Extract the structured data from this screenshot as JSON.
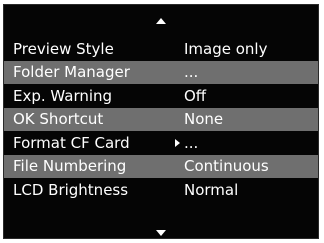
{
  "menu": {
    "items": [
      {
        "label": "Preview Style",
        "value": "Image only",
        "shaded": false,
        "pointer": false
      },
      {
        "label": "Folder Manager",
        "value": "...",
        "shaded": true,
        "pointer": false
      },
      {
        "label": "Exp. Warning",
        "value": "Off",
        "shaded": false,
        "pointer": false
      },
      {
        "label": "OK Shortcut",
        "value": "None",
        "shaded": true,
        "pointer": false
      },
      {
        "label": "Format CF Card",
        "value": "...",
        "shaded": false,
        "pointer": true
      },
      {
        "label": "File Numbering",
        "value": "Continuous",
        "shaded": true,
        "pointer": false
      },
      {
        "label": "LCD Brightness",
        "value": "Normal",
        "shaded": false,
        "pointer": false
      }
    ]
  },
  "icons": {
    "scroll_up": "triangle-up-icon",
    "scroll_down": "triangle-down-icon",
    "pointer": "triangle-right-icon"
  },
  "colors": {
    "background": "#050505",
    "shaded_row": "#6f6f6f",
    "text": "#ffffff"
  }
}
